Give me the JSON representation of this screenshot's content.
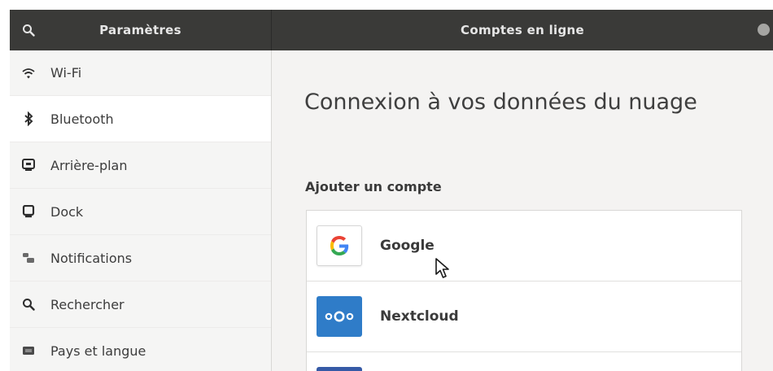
{
  "header": {
    "left_title": "Paramètres",
    "right_title": "Comptes en ligne",
    "search_icon": "search-icon",
    "close_icon": "close-icon"
  },
  "sidebar": {
    "items": [
      {
        "label": "Wi-Fi",
        "icon": "wifi-icon"
      },
      {
        "label": "Bluetooth",
        "icon": "bluetooth-icon",
        "selected": true
      },
      {
        "label": "Arrière-plan",
        "icon": "background-icon"
      },
      {
        "label": "Dock",
        "icon": "dock-icon"
      },
      {
        "label": "Notifications",
        "icon": "notifications-icon"
      },
      {
        "label": "Rechercher",
        "icon": "search-icon"
      },
      {
        "label": "Pays et langue",
        "icon": "region-icon"
      }
    ]
  },
  "main": {
    "title": "Connexion à vos données du nuage",
    "section_label": "Ajouter un compte",
    "accounts": [
      {
        "label": "Google",
        "icon": "google-icon"
      },
      {
        "label": "Nextcloud",
        "icon": "nextcloud-icon"
      },
      {
        "label": "",
        "icon": "facebook-icon"
      }
    ]
  },
  "colors": {
    "headerbar": "#3a3a38",
    "sidebar_bg": "#f5f5f4",
    "main_bg": "#f4f3f2",
    "nextcloud_blue": "#2f7cc8"
  }
}
